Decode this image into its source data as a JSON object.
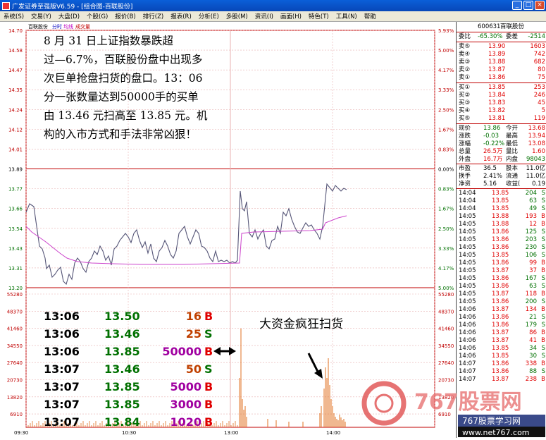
{
  "window": {
    "title": "广发证券至强版V6.59 - [组合图-百联股份]",
    "buttons": [
      "_",
      "□",
      "×"
    ]
  },
  "menu": [
    "系统(S)",
    "交易(Y)",
    "大盘(D)",
    "个股(G)",
    "报价(B)",
    "排行(Z)",
    "报表(R)",
    "分析(E)",
    "多股(M)",
    "资讯(I)",
    "画面(H)",
    "特色(T)",
    "工具(N)",
    "帮助"
  ],
  "chart": {
    "header": {
      "name": "百联股份",
      "tab": "分时",
      "legend1": "均线",
      "legend2": "成交量"
    },
    "price_ticks": [
      "14.70",
      "14.58",
      "14.47",
      "14.35",
      "14.24",
      "14.12",
      "14.01",
      "13.89",
      "13.77",
      "13.66",
      "13.54",
      "13.43",
      "13.31",
      "13.20"
    ],
    "pct_ticks": [
      "5.93%",
      "5.00%",
      "4.17%",
      "3.33%",
      "2.50%",
      "1.67%",
      "0.83%",
      "0.00%",
      "0.83%",
      "1.67%",
      "2.50%",
      "3.33%",
      "4.17%",
      "5.00%"
    ],
    "vol_ticks": [
      "55280",
      "48370",
      "41460",
      "34550",
      "27640",
      "20730",
      "13820",
      "6910"
    ],
    "time_ticks": [
      "09:30",
      "10:30",
      "13:00",
      "14:00"
    ],
    "annotation": "8 月 31 日上证指数暴跌超过—6.7%，百联股份盘中出现多次巨单抢盘扫货的盘口。13：06分一张数量达到50000手的买单由 13.46 元扫高至 13.85 元。机构的入市方式和手法非常凶狠！",
    "annotation_lines": [
      "8 月 31 日上证指数暴跌超",
      "过—6.7%，百联股份盘中出现多",
      "次巨单抢盘扫货的盘口。13：06",
      "分一张数量达到50000手的买单",
      "由 13.46 元扫高至 13.85 元。机",
      "构的入市方式和手法非常凶狠！"
    ],
    "callout": "大资金疯狂扫货",
    "trades": [
      {
        "time": "13:06",
        "price": "13.50",
        "vol": "16",
        "side": "B"
      },
      {
        "time": "13:06",
        "price": "13.46",
        "vol": "25",
        "side": "S"
      },
      {
        "time": "13:06",
        "price": "13.85",
        "vol": "50000",
        "side": "B"
      },
      {
        "time": "13:07",
        "price": "13.46",
        "vol": "50",
        "side": "S"
      },
      {
        "time": "13:07",
        "price": "13.85",
        "vol": "5000",
        "side": "B"
      },
      {
        "time": "13:07",
        "price": "13.85",
        "vol": "3000",
        "side": "B"
      },
      {
        "time": "13:07",
        "price": "13.84",
        "vol": "1020",
        "side": "B"
      }
    ]
  },
  "panel": {
    "code": "600631",
    "name": "百联股份",
    "ratio": {
      "l1": "委比",
      "v1": "-65.30%",
      "l2": "委差",
      "v2": "-2514"
    },
    "asks": [
      [
        "卖⑤",
        "13.90",
        "1603"
      ],
      [
        "卖④",
        "13.89",
        "742"
      ],
      [
        "卖③",
        "13.88",
        "682"
      ],
      [
        "卖②",
        "13.87",
        "80"
      ],
      [
        "卖①",
        "13.86",
        "75"
      ]
    ],
    "bids": [
      [
        "买①",
        "13.85",
        "253"
      ],
      [
        "买②",
        "13.84",
        "246"
      ],
      [
        "买③",
        "13.83",
        "45"
      ],
      [
        "买④",
        "13.82",
        "5"
      ],
      [
        "买⑤",
        "13.81",
        "119"
      ]
    ],
    "stats": [
      [
        "现价",
        "13.86",
        "今开",
        "13.68"
      ],
      [
        "涨跌",
        "-0.03",
        "最高",
        "13.94"
      ],
      [
        "涨幅",
        "-0.22%",
        "最低",
        "13.08"
      ],
      [
        "总量",
        "26.5万",
        "量比",
        "1.60"
      ],
      [
        "外盘",
        "16.7万",
        "内盘",
        "98043"
      ]
    ],
    "stats2": [
      [
        "市盈",
        "36.5",
        "股本",
        "11.0亿"
      ],
      [
        "换手",
        "2.41%",
        "流通",
        "11.0亿"
      ],
      [
        "净资",
        "5.16",
        "收益(",
        "0.19"
      ]
    ],
    "ticks": [
      [
        "14:04",
        "13.85",
        "204",
        "S"
      ],
      [
        "14:04",
        "13.85",
        "63",
        "S"
      ],
      [
        "14:04",
        "13.85",
        "49",
        "S"
      ],
      [
        "14:05",
        "13.88",
        "193",
        "B"
      ],
      [
        "14:05",
        "13.88",
        "12",
        "B"
      ],
      [
        "14:05",
        "13.86",
        "125",
        "S"
      ],
      [
        "14:05",
        "13.86",
        "203",
        "S"
      ],
      [
        "14:05",
        "13.86",
        "230",
        "S"
      ],
      [
        "14:05",
        "13.85",
        "106",
        "S"
      ],
      [
        "14:05",
        "13.86",
        "99",
        "B"
      ],
      [
        "14:05",
        "13.87",
        "37",
        "B"
      ],
      [
        "14:05",
        "13.86",
        "167",
        "S"
      ],
      [
        "14:05",
        "13.86",
        "63",
        "S"
      ],
      [
        "14:05",
        "13.87",
        "118",
        "B"
      ],
      [
        "14:05",
        "13.86",
        "200",
        "S"
      ],
      [
        "14:06",
        "13.87",
        "134",
        "B"
      ],
      [
        "14:06",
        "13.86",
        "21",
        "S"
      ],
      [
        "14:06",
        "13.86",
        "179",
        "S"
      ],
      [
        "14:06",
        "13.87",
        "86",
        "B"
      ],
      [
        "14:06",
        "13.87",
        "41",
        "B"
      ],
      [
        "14:06",
        "13.85",
        "34",
        "S"
      ],
      [
        "14:06",
        "13.85",
        "30",
        "S"
      ],
      [
        "14:07",
        "13.86",
        "338",
        "B"
      ],
      [
        "14:07",
        "13.86",
        "88",
        "S"
      ],
      [
        "14:07",
        "13.87",
        "238",
        "B"
      ]
    ]
  },
  "watermark": {
    "brand": "767股票网",
    "sub": "767股票学习网",
    "url": "www.net767.com"
  }
}
